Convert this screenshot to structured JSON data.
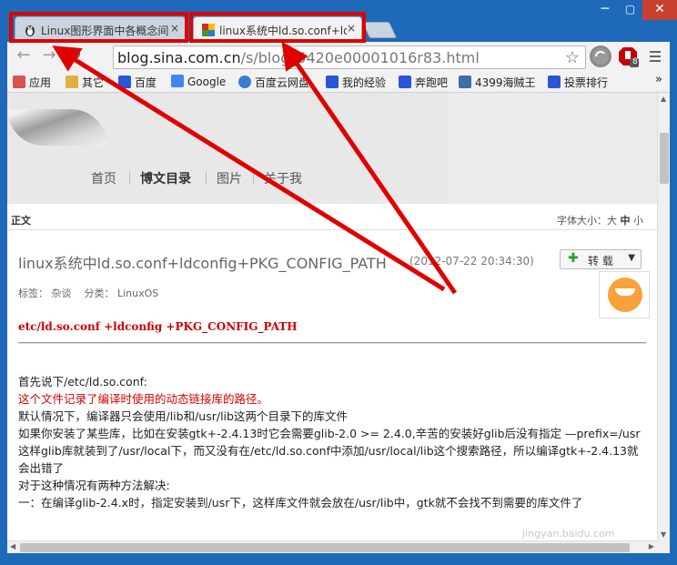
{
  "window": {
    "min_label": "─",
    "max_label": "▢",
    "close_label": "✕"
  },
  "tabs": [
    {
      "label": "Linux图形界面中各概念间",
      "close": "×",
      "active": false,
      "favicon_color": "#3b8a3b"
    },
    {
      "label": "linux系统中ld.so.conf+ld",
      "close": "×",
      "active": true,
      "favicon_color": "#d62a1f"
    }
  ],
  "toolbar": {
    "back": "←",
    "forward": "→",
    "reload": "↻",
    "url_domain": "blog.sina.com.cn",
    "url_path": "/s/blog_5420e00001016r83.html",
    "star": "☆",
    "ext_badge": "8"
  },
  "bookmarks": [
    {
      "label": "应用",
      "icon": "apps-grid-icon",
      "color": "#d9534f"
    },
    {
      "label": "其它",
      "icon": "folder-icon",
      "color": "#e0b040"
    },
    {
      "label": "百度",
      "icon": "baidu-paw-icon",
      "color": "#2a55d6"
    },
    {
      "label": "Google",
      "icon": "google-icon",
      "color": "#4285f4"
    },
    {
      "label": "百度云网盘",
      "icon": "cloud-icon",
      "color": "#3a7bd5"
    },
    {
      "label": "我的经验",
      "icon": "baidu-paw-icon",
      "color": "#2a55d6"
    },
    {
      "label": "奔跑吧",
      "icon": "baidu-paw-icon",
      "color": "#2a55d6"
    },
    {
      "label": "4399海贼王",
      "icon": "game-icon",
      "color": "#3d6ea8"
    },
    {
      "label": "投票排行",
      "icon": "baidu-paw-icon",
      "color": "#2a55d6"
    }
  ],
  "bookmarks_more": "»",
  "blog_nav": [
    "首页",
    "博文目录",
    "图片",
    "关于我"
  ],
  "section_label": "正文",
  "font_size": {
    "label": "字体大小：",
    "big": "大",
    "mid": "中",
    "small": "小"
  },
  "article": {
    "title": "linux系统中ld.so.conf+ldconfig+PKG_CONFIG_PATH",
    "date": "(2012-07-22 20:34:30)",
    "reprint_label": "转 载",
    "tags_label": "标签：",
    "tag": "杂谈",
    "category_label": "分类：",
    "category": "LinuxOS",
    "heading": "etc/ld.so.conf +ldconfig +PKG_CONFIG_PATH",
    "paragraphs": [
      "首先说下/etc/ld.so.conf:",
      "这个文件记录了编译时使用的动态链接库的路径。",
      "默认情况下，编译器只会使用/lib和/usr/lib这两个目录下的库文件",
      "如果你安装了某些库，比如在安装gtk+-2.4.13时它会需要glib-2.0 >= 2.4.0,辛苦的安装好glib后没有指定 —prefix=/usr 这样glib库就装到了/usr/local下，而又没有在/etc/ld.so.conf中添加/usr/local/lib这个搜索路径，所以编译gtk+-2.4.13就会出错了",
      "对于这种情况有两种方法解决:",
      "一：在编译glib-2.4.x时，指定安装到/usr下，这样库文件就会放在/usr/lib中，gtk就不会找不到需要的库文件了"
    ]
  },
  "watermark": "jingyan.baidu.com",
  "colors": {
    "annotation_red": "#e00000",
    "title_red": "#c00000",
    "window_blue": "#1e6ab9"
  }
}
